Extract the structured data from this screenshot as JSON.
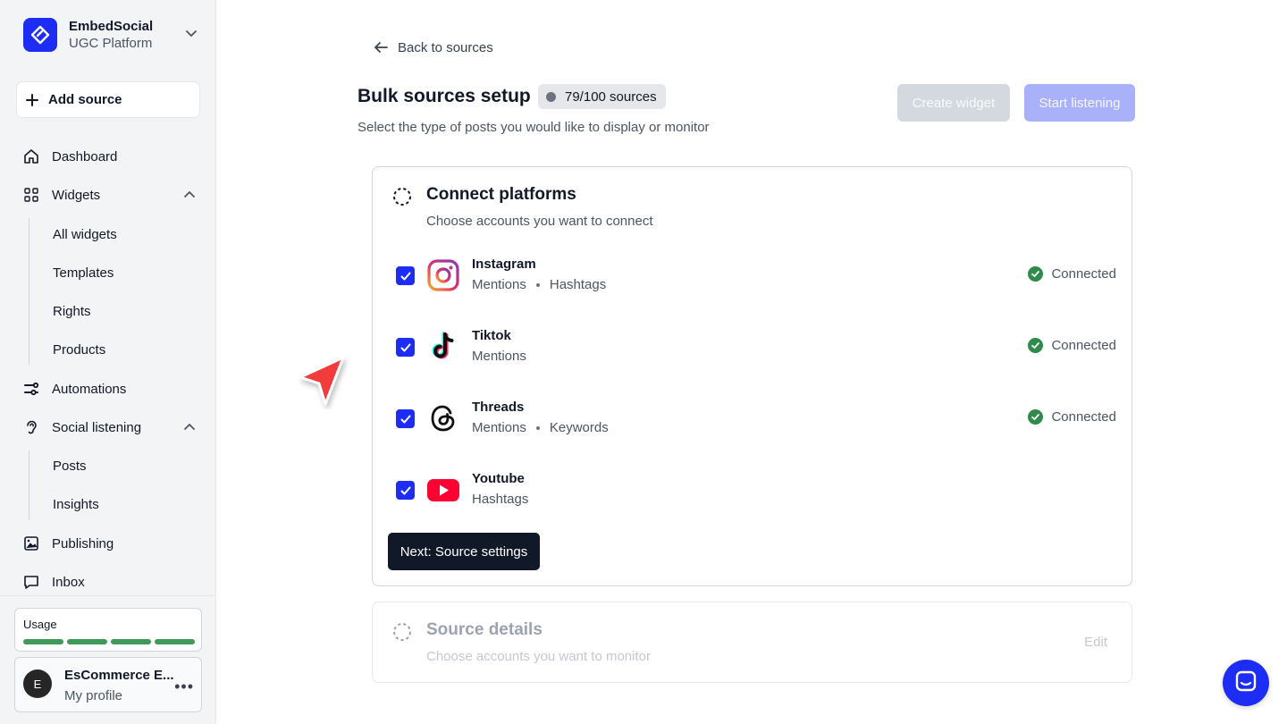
{
  "brand": {
    "name": "EmbedSocial",
    "subtitle": "UGC Platform"
  },
  "sidebar": {
    "add_source": "Add source",
    "nav": {
      "dashboard": "Dashboard",
      "widgets": "Widgets",
      "widgets_sub": [
        "All widgets",
        "Templates",
        "Rights",
        "Products"
      ],
      "automations": "Automations",
      "social_listening": "Social listening",
      "social_listening_sub": [
        "Posts",
        "Insights"
      ],
      "publishing": "Publishing",
      "inbox": "Inbox"
    },
    "usage": {
      "label": "Usage",
      "fill_fraction": 1.0,
      "color": "#3f9a5a"
    },
    "profile": {
      "initial": "E",
      "name": "EsCommerce E...",
      "subtitle": "My profile"
    }
  },
  "main": {
    "back_link": "Back to sources",
    "title": "Bulk sources setup",
    "source_count": "79/100 sources",
    "subtitle": "Select the type of posts you would like to display or monitor",
    "create_widget": "Create widget",
    "start_listening": "Start listening"
  },
  "connect_card": {
    "title": "Connect platforms",
    "subtitle": "Choose accounts you want to connect",
    "platforms": [
      {
        "name": "Instagram",
        "tags": [
          "Mentions",
          "Hashtags"
        ],
        "status": "Connected",
        "checked": true,
        "icon": "instagram-icon"
      },
      {
        "name": "Tiktok",
        "tags": [
          "Mentions"
        ],
        "status": "Connected",
        "checked": true,
        "icon": "tiktok-icon"
      },
      {
        "name": "Threads",
        "tags": [
          "Mentions",
          "Keywords"
        ],
        "status": "Connected",
        "checked": true,
        "icon": "threads-icon"
      },
      {
        "name": "Youtube",
        "tags": [
          "Hashtags"
        ],
        "status": "",
        "checked": true,
        "icon": "youtube-icon"
      }
    ],
    "next_button": "Next: Source settings"
  },
  "details_card": {
    "title": "Source details",
    "subtitle": "Choose accounts you want to monitor",
    "edit": "Edit"
  },
  "colors": {
    "accent": "#1d2df5",
    "success": "#2f8a4c",
    "dark": "#111827"
  }
}
